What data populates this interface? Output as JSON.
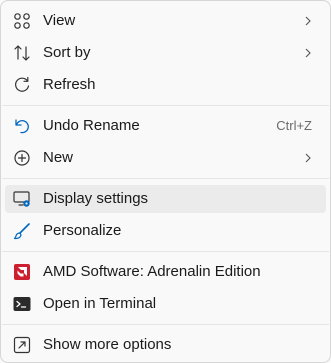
{
  "menu": {
    "items": {
      "view": {
        "label": "View",
        "icon": "grid-icon",
        "submenu": true
      },
      "sort_by": {
        "label": "Sort by",
        "icon": "sort-arrows-icon",
        "submenu": true
      },
      "refresh": {
        "label": "Refresh",
        "icon": "refresh-icon"
      },
      "undo_rename": {
        "label": "Undo Rename",
        "icon": "undo-icon",
        "shortcut": "Ctrl+Z"
      },
      "new": {
        "label": "New",
        "icon": "plus-circle-icon",
        "submenu": true
      },
      "display_settings": {
        "label": "Display settings",
        "icon": "display-settings-icon",
        "highlighted": true
      },
      "personalize": {
        "label": "Personalize",
        "icon": "brush-icon"
      },
      "amd_software": {
        "label": "AMD Software: Adrenalin Edition",
        "icon": "amd-logo-icon"
      },
      "open_terminal": {
        "label": "Open in Terminal",
        "icon": "terminal-icon"
      },
      "show_more": {
        "label": "Show more options",
        "icon": "expand-icon"
      }
    }
  },
  "colors": {
    "background": "#f9f9f9",
    "hover": "#ebebeb",
    "accent": "#0067c0",
    "amd_red": "#cc1f2f"
  }
}
